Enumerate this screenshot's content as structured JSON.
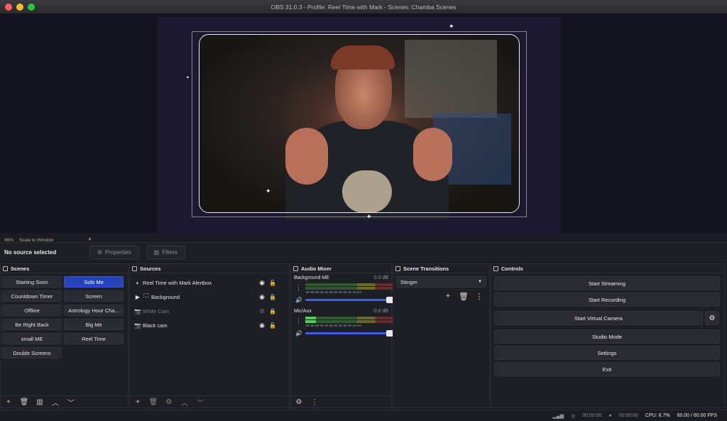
{
  "window": {
    "title": "OBS 31.0.3 - Profile: Reel Time with Mark - Scenes: Chamba Scenes"
  },
  "preview": {
    "zoom": "46%",
    "scale_mode": "Scale to Window"
  },
  "source_toolbar": {
    "status": "No source selected",
    "properties_label": "Properties",
    "filters_label": "Filters"
  },
  "scenes": {
    "title": "Scenes",
    "items": [
      {
        "label": "Starting Soon",
        "active": false
      },
      {
        "label": "Solo Me",
        "active": true
      },
      {
        "label": "Countdown Timer",
        "active": false
      },
      {
        "label": "Screen",
        "active": false
      },
      {
        "label": "Offline",
        "active": false
      },
      {
        "label": "Astrology Hour Cha...",
        "active": false
      },
      {
        "label": "Be Right Back",
        "active": false
      },
      {
        "label": "Big Me",
        "active": false
      },
      {
        "label": "small ME",
        "active": false
      },
      {
        "label": "Reel Time",
        "active": false
      },
      {
        "label": "Double Screens",
        "active": false
      }
    ]
  },
  "sources": {
    "title": "Sources",
    "items": [
      {
        "label": "Reel Time with Mark Alertbox",
        "icon": "browser-icon",
        "visible": true,
        "locked": false
      },
      {
        "label": "Background",
        "icon": "folder-icon",
        "visible": true,
        "locked": true,
        "group": true
      },
      {
        "label": "White Cam",
        "icon": "camera-icon",
        "visible": false,
        "locked": true
      },
      {
        "label": "Black cam",
        "icon": "camera-icon",
        "visible": true,
        "locked": false
      }
    ]
  },
  "audio_mixer": {
    "title": "Audio Mixer",
    "channels": [
      {
        "name": "Background ME",
        "db": "0.0 dB",
        "level": 0.0
      },
      {
        "name": "Mic/Aux",
        "db": "0.0 dB",
        "level": 0.12
      }
    ],
    "ticks": "-60 -55 -50 -45 -40 -35 -30 -25 -20 -15 -10 -5 0"
  },
  "transitions": {
    "title": "Scene Transitions",
    "selected": "Stinger"
  },
  "controls": {
    "title": "Controls",
    "start_streaming": "Start Streaming",
    "start_recording": "Start Recording",
    "start_virtual_camera": "Start Virtual Camera",
    "studio_mode": "Studio Mode",
    "settings": "Settings",
    "exit": "Exit"
  },
  "status": {
    "stream_time": "00:00:00",
    "record_time": "00:00:00",
    "cpu": "CPU: 6.7%",
    "fps": "60.00 / 60.00 FPS"
  },
  "colors": {
    "accent": "#2544b4",
    "background": "#1e1e25"
  }
}
